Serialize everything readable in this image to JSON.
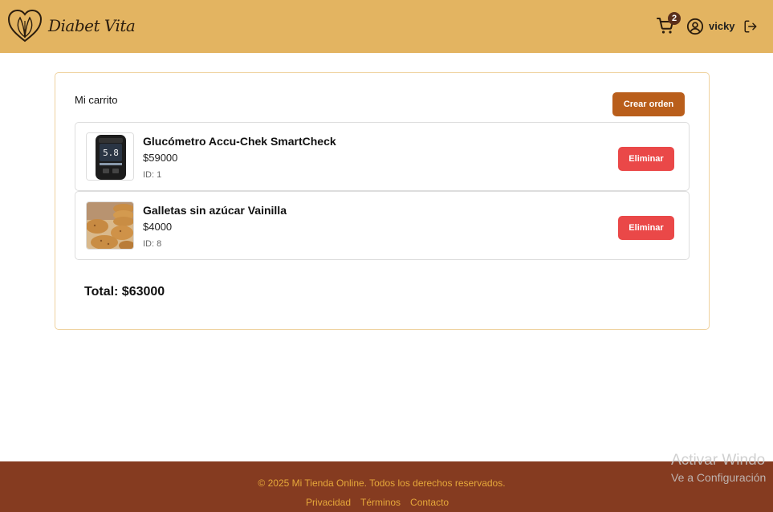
{
  "header": {
    "brand": "Diabet Vita",
    "cart_count": "2",
    "username": "vicky"
  },
  "cart": {
    "title": "Mi carrito",
    "create_order_label": "Crear orden",
    "items": [
      {
        "name": "Glucómetro Accu-Chek SmartCheck",
        "price": "$59000",
        "id": "ID: 1",
        "remove_label": "Eliminar",
        "image": "glucometer"
      },
      {
        "name": "Galletas sin azúcar Vainilla",
        "price": "$4000",
        "id": "ID: 8",
        "remove_label": "Eliminar",
        "image": "cookies"
      }
    ],
    "total": "Total: $63000"
  },
  "footer": {
    "copyright": "© 2025 Mi Tienda Online. Todos los derechos reservados.",
    "links": [
      "Privacidad",
      "Términos",
      "Contacto"
    ]
  },
  "watermark": {
    "line1": "Activar Windo",
    "line2": "Ve a Configuración"
  },
  "colors": {
    "header_bg": "#e3b461",
    "footer_bg": "#853b20",
    "footer_text": "#e6a83a",
    "create_button": "#b95e1b",
    "remove_button": "#ea4848"
  },
  "icons": [
    "heart-leaf-logo-icon",
    "cart-icon",
    "user-circle-icon",
    "logout-icon"
  ]
}
